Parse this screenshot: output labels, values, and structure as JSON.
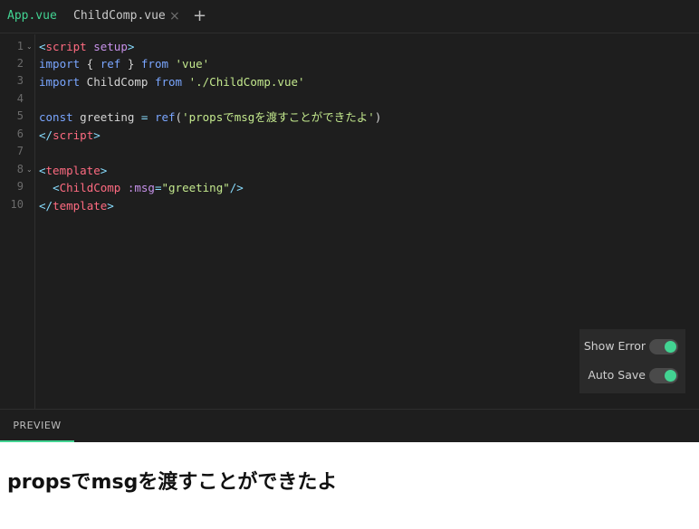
{
  "tabs": [
    {
      "label": "App.vue",
      "active": true
    },
    {
      "label": "ChildComp.vue",
      "active": false
    }
  ],
  "tab_close_symbol": "×",
  "tab_add_symbol": "+",
  "line_numbers": [
    "1",
    "2",
    "3",
    "4",
    "5",
    "6",
    "7",
    "8",
    "9",
    "10"
  ],
  "code": {
    "l1": {
      "lt": "<",
      "tag": "script",
      "attr": " setup",
      "gt": ">"
    },
    "l2": {
      "kw1": "import",
      "mid": " { ",
      "name": "ref",
      "mid2": " } ",
      "kw2": "from",
      "sp": " ",
      "str": "'vue'"
    },
    "l3": {
      "kw1": "import",
      "mid": " ChildComp ",
      "kw2": "from",
      "sp": " ",
      "str": "'./ChildComp.vue'"
    },
    "l5": {
      "kw1": "const",
      "mid": " greeting ",
      "eq": "=",
      "sp": " ",
      "fn": "ref",
      "open": "(",
      "str": "'propsでmsgを渡すことができたよ'",
      "close": ")"
    },
    "l6": {
      "lt": "</",
      "tag": "script",
      "gt": ">"
    },
    "l8": {
      "lt": "<",
      "tag": "template",
      "gt": ">"
    },
    "l9": {
      "indent": "  ",
      "lt": "<",
      "tag": "ChildComp",
      "attr": " :msg",
      "eq": "=",
      "str": "\"greeting\"",
      "gt": "/>"
    },
    "l10": {
      "lt": "</",
      "tag": "template",
      "gt": ">"
    }
  },
  "toggles": {
    "show_error": {
      "label": "Show Error",
      "on": true
    },
    "auto_save": {
      "label": "Auto Save",
      "on": true
    }
  },
  "preview_tab": "PREVIEW",
  "preview_heading": "propsでmsgを渡すことができたよ",
  "colors": {
    "accent": "#42d392",
    "editor_bg": "#1e1e1e"
  }
}
